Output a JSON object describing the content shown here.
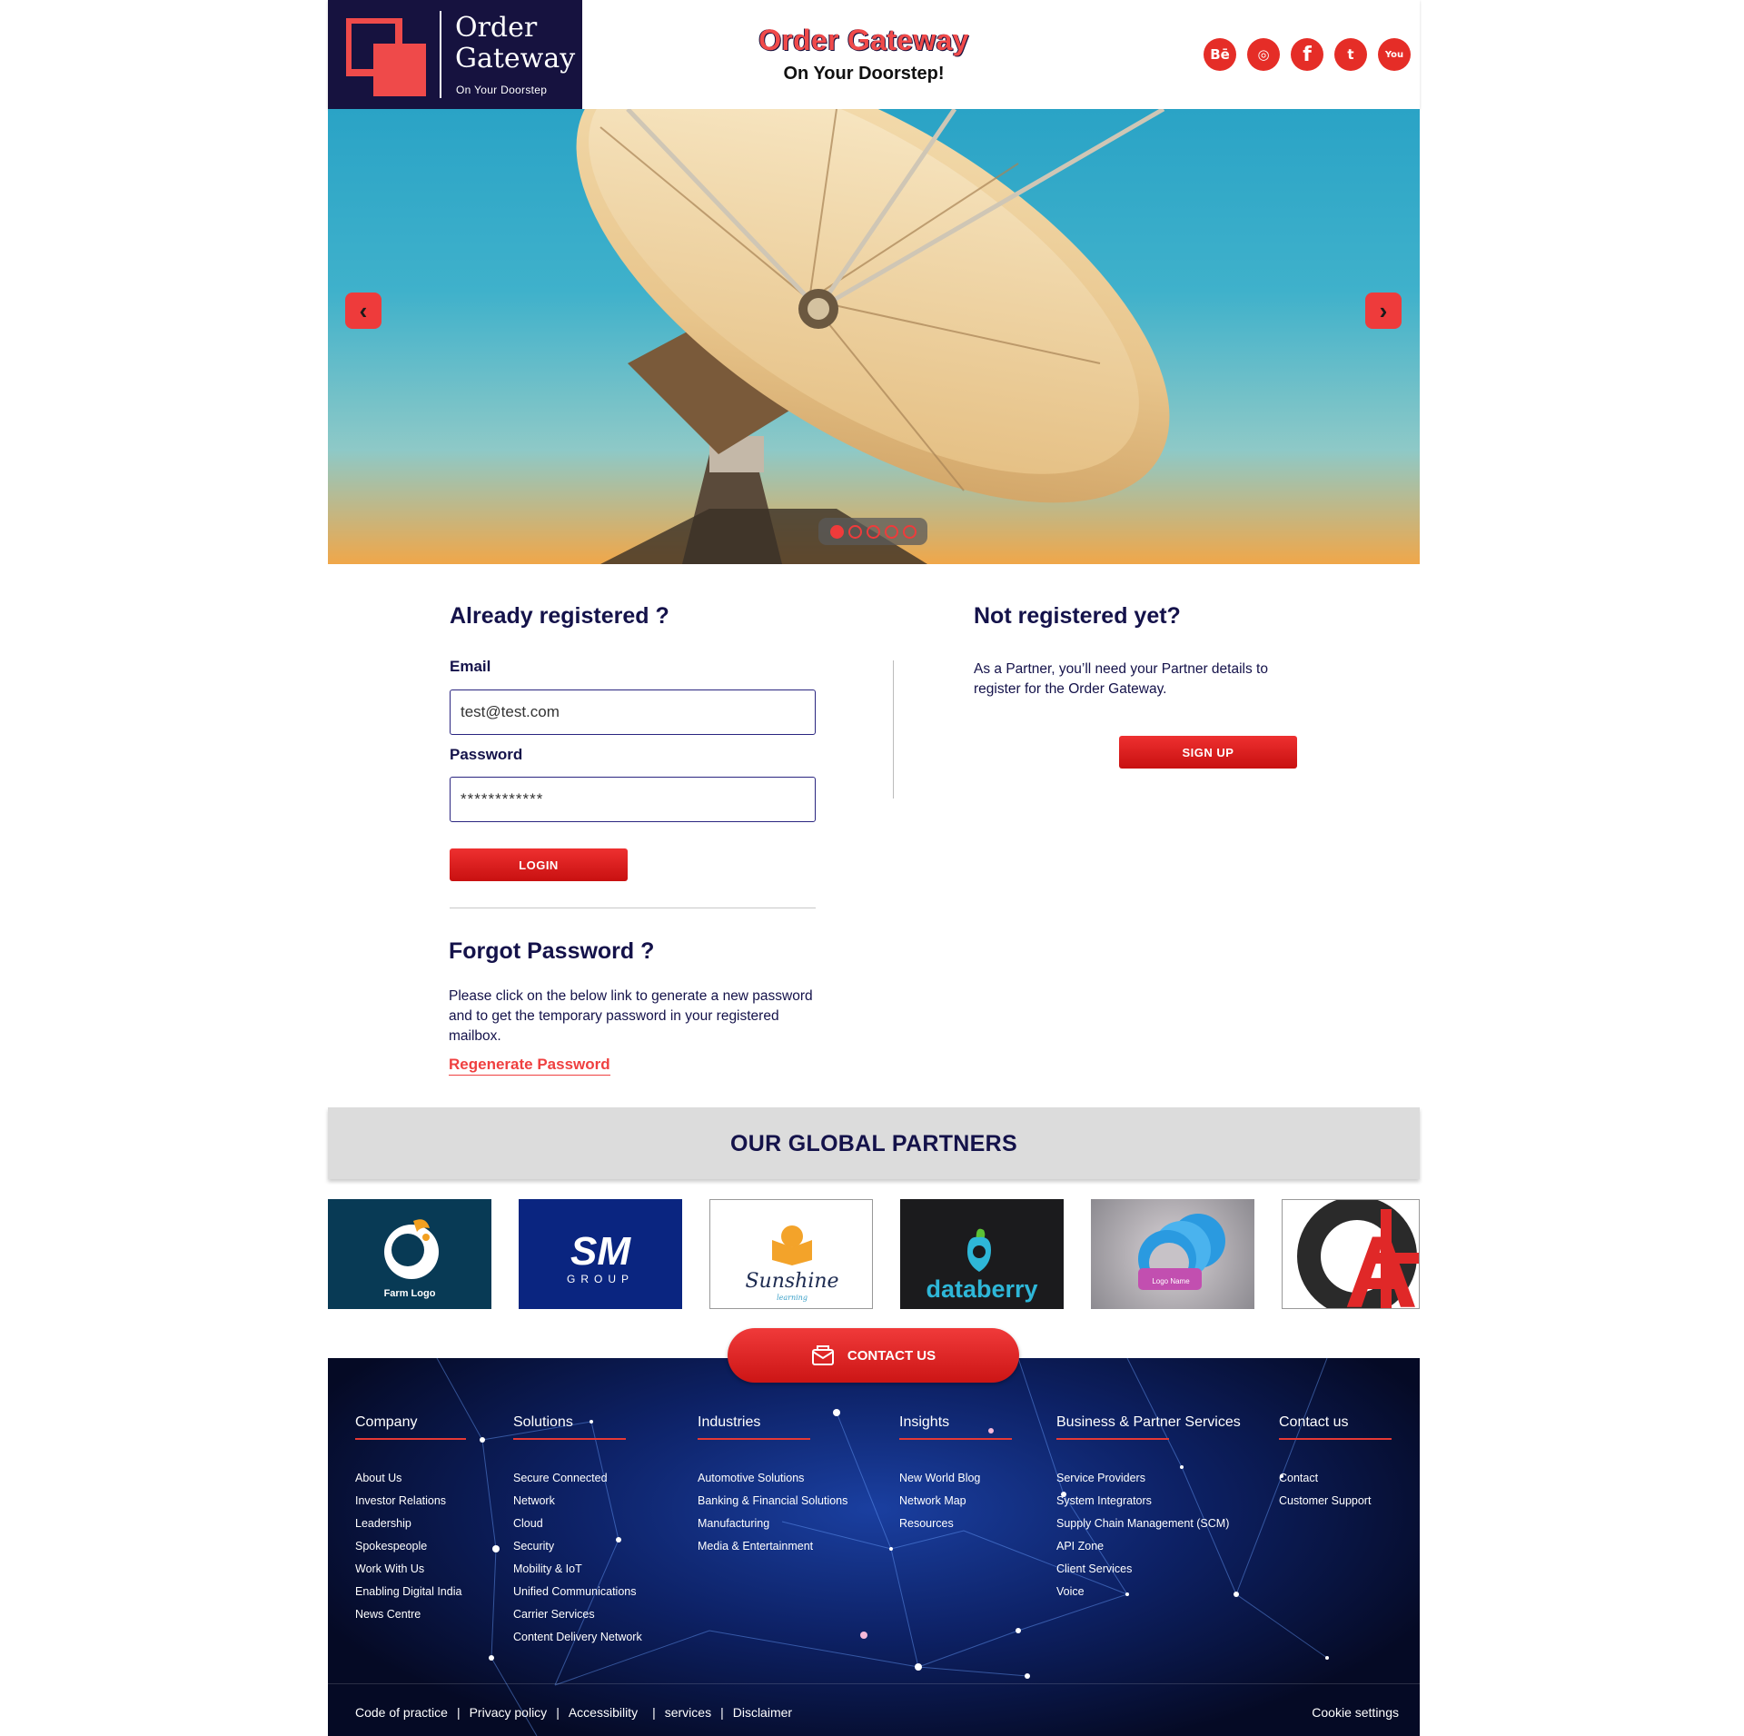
{
  "brand": {
    "logo_line1": "Order",
    "logo_line2": "Gateway",
    "logo_tagline": "On Your Doorstep",
    "title": "Order Gateway",
    "subtitle": "On Your Doorstep!"
  },
  "socials": [
    {
      "icon": "behance-icon",
      "glyph": "Bē"
    },
    {
      "icon": "dribbble-icon",
      "glyph": "◎"
    },
    {
      "icon": "facebook-icon",
      "glyph": "f"
    },
    {
      "icon": "twitter-icon",
      "glyph": "t"
    },
    {
      "icon": "youtube-icon",
      "glyph": "You"
    }
  ],
  "carousel": {
    "prev_glyph": "‹",
    "next_glyph": "›",
    "slide_count": 5,
    "active_index": 0
  },
  "login": {
    "heading": "Already registered ?",
    "email_label": "Email",
    "email_value": "test@test.com",
    "password_label": "Password",
    "password_value": "************",
    "button": "LOGIN"
  },
  "forgot": {
    "heading": "Forgot Password ?",
    "text": "Please click on the below link to generate a new password and to get the temporary password in your registered mailbox.",
    "link": "Regenerate Password"
  },
  "register": {
    "heading": "Not registered yet?",
    "text": "As a Partner, you’ll need your Partner details to register for the Order Gateway.",
    "button": "SIGN UP"
  },
  "partners": {
    "title": "OUR GLOBAL PARTNERS",
    "logos": [
      {
        "name": "Farm Logo",
        "text": "Farm Logo"
      },
      {
        "name": "SM Group",
        "text": "GROUP"
      },
      {
        "name": "Sunshine",
        "text": "Sunshine",
        "sub": "learning"
      },
      {
        "name": "databerry",
        "text": "databerry"
      },
      {
        "name": "Logo Name",
        "text": "Logo Name"
      },
      {
        "name": "A4",
        "text": "A"
      }
    ]
  },
  "contact_button": "CONTACT US",
  "footer": {
    "columns": [
      {
        "heading": "Company",
        "items": [
          "About Us",
          "Investor Relations",
          "Leadership",
          "Spokespeople",
          "Work With Us",
          "Enabling Digital India",
          "News Centre"
        ]
      },
      {
        "heading": "Solutions",
        "items": [
          "Secure Connected",
          "Network",
          "Cloud",
          "Security",
          "Mobility & IoT",
          "Unified Communications",
          "Carrier Services",
          "Content Delivery Network"
        ]
      },
      {
        "heading": "Industries",
        "items": [
          "Automotive Solutions",
          "Banking & Financial Solutions",
          "Manufacturing",
          "Media & Entertainment"
        ]
      },
      {
        "heading": "Insights",
        "items": [
          "New World Blog",
          "Network Map",
          "Resources"
        ]
      },
      {
        "heading": "Business & Partner Services",
        "items": [
          "Service Providers",
          "System Integrators",
          "Supply Chain Management (SCM)",
          "API Zone",
          "Client Services",
          "Voice"
        ]
      },
      {
        "heading": "Contact us",
        "items": [
          "Contact",
          "Customer Support"
        ]
      }
    ],
    "bottom_links": [
      "Code of practice",
      "Privacy policy",
      "Accessibility",
      "services",
      "Disclaimer"
    ],
    "cookie": "Cookie settings"
  },
  "colors": {
    "accent": "#e52d27",
    "navy": "#14124a",
    "logo_bg": "#16123f"
  }
}
